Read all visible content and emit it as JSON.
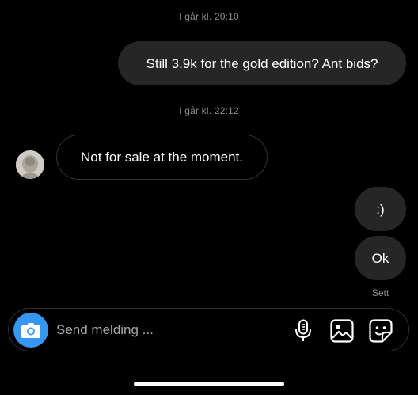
{
  "thread": {
    "timestamp_1": "I går kl. 20:10",
    "timestamp_2": "I går kl. 22:12",
    "messages": [
      {
        "direction": "outgoing",
        "text": "Still 3.9k for the gold edition? Ant bids?"
      },
      {
        "direction": "incoming",
        "text": "Not for sale at the moment."
      },
      {
        "direction": "outgoing",
        "text": ":)"
      },
      {
        "direction": "outgoing",
        "text": "Ok"
      }
    ],
    "seen_label": "Sett"
  },
  "composer": {
    "placeholder": "Send melding ...",
    "icons": [
      "camera-icon",
      "microphone-icon",
      "gallery-icon",
      "sticker-icon"
    ]
  },
  "colors": {
    "background": "#000000",
    "outgoing_bubble": "#262626",
    "incoming_border": "#333333",
    "camera_button": "#3797f0",
    "meta_text": "#8e8e93"
  }
}
